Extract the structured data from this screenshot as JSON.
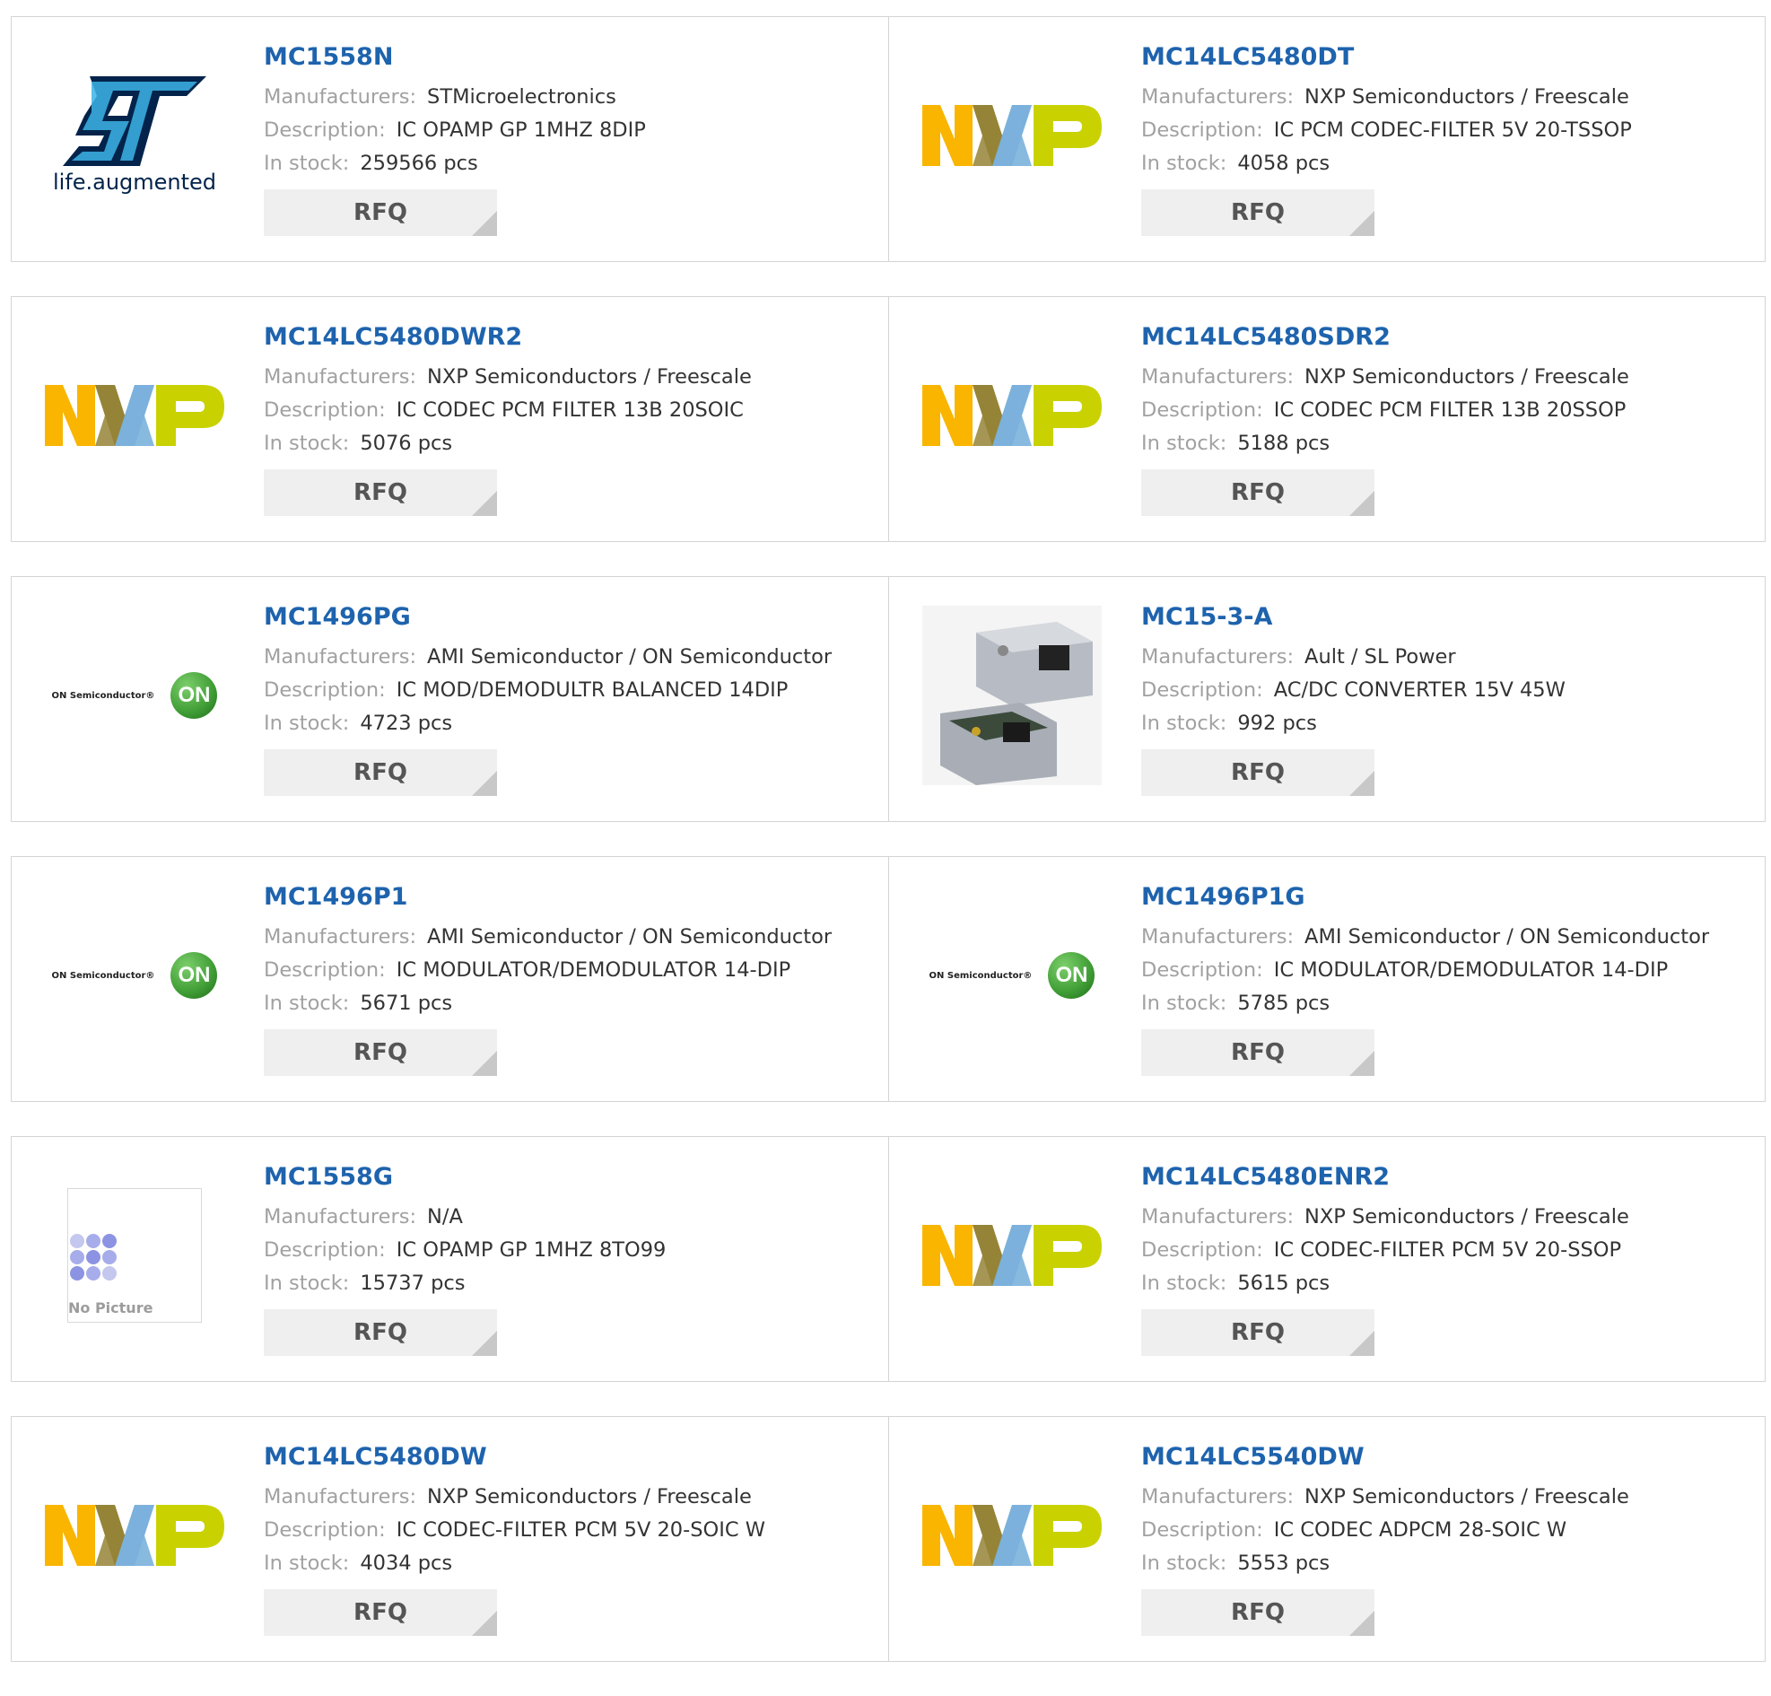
{
  "labels": {
    "manufacturers": "Manufacturers:",
    "description": "Description:",
    "in_stock": "In stock:",
    "rfq": "RFQ"
  },
  "products": [
    {
      "part": "MC1558N",
      "manufacturer": "STMicroelectronics",
      "description": "IC OPAMP GP 1MHZ 8DIP",
      "stock": "259566 pcs",
      "logo": "st-logo",
      "logo_text": "life.augmented"
    },
    {
      "part": "MC14LC5480DT",
      "manufacturer": "NXP Semiconductors / Freescale",
      "description": "IC PCM CODEC-FILTER 5V 20-TSSOP",
      "stock": "4058 pcs",
      "logo": "nxp-logo"
    },
    {
      "part": "MC14LC5480DWR2",
      "manufacturer": "NXP Semiconductors / Freescale",
      "description": "IC CODEC PCM FILTER 13B 20SOIC",
      "stock": "5076 pcs",
      "logo": "nxp-logo"
    },
    {
      "part": "MC14LC5480SDR2",
      "manufacturer": "NXP Semiconductors / Freescale",
      "description": "IC CODEC PCM FILTER 13B 20SSOP",
      "stock": "5188 pcs",
      "logo": "nxp-logo"
    },
    {
      "part": "MC1496PG",
      "manufacturer": "AMI Semiconductor / ON Semiconductor",
      "description": "IC MOD/DEMODULTR BALANCED 14DIP",
      "stock": "4723 pcs",
      "logo": "on-semiconductor-logo",
      "logo_text": "ON Semiconductor®",
      "logo_badge": "ON"
    },
    {
      "part": "MC15-3-A",
      "manufacturer": "Ault / SL Power",
      "description": "AC/DC CONVERTER 15V 45W",
      "stock": "992 pcs",
      "logo": "power-supply-photo"
    },
    {
      "part": "MC1496P1",
      "manufacturer": "AMI Semiconductor / ON Semiconductor",
      "description": "IC MODULATOR/DEMODULATOR 14-DIP",
      "stock": "5671 pcs",
      "logo": "on-semiconductor-logo",
      "logo_text": "ON Semiconductor®",
      "logo_badge": "ON"
    },
    {
      "part": "MC1496P1G",
      "manufacturer": "AMI Semiconductor / ON Semiconductor",
      "description": "IC MODULATOR/DEMODULATOR 14-DIP",
      "stock": "5785 pcs",
      "logo": "on-semiconductor-logo",
      "logo_text": "ON Semiconductor®",
      "logo_badge": "ON"
    },
    {
      "part": "MC1558G",
      "manufacturer": "N/A",
      "description": "IC OPAMP GP 1MHZ 8TO99",
      "stock": "15737 pcs",
      "logo": "no-picture-placeholder",
      "logo_text": "No Picture"
    },
    {
      "part": "MC14LC5480ENR2",
      "manufacturer": "NXP Semiconductors / Freescale",
      "description": "IC CODEC-FILTER PCM 5V 20-SSOP",
      "stock": "5615 pcs",
      "logo": "nxp-logo"
    },
    {
      "part": "MC14LC5480DW",
      "manufacturer": "NXP Semiconductors / Freescale",
      "description": "IC CODEC-FILTER PCM 5V 20-SOIC W",
      "stock": "4034 pcs",
      "logo": "nxp-logo"
    },
    {
      "part": "MC14LC5540DW",
      "manufacturer": "NXP Semiconductors / Freescale",
      "description": "IC CODEC ADPCM 28-SOIC W",
      "stock": "5553 pcs",
      "logo": "nxp-logo"
    }
  ],
  "colors": {
    "link": "#1e63ad",
    "label": "#a1a1a1",
    "value": "#333333",
    "border": "#d4d4d4",
    "button_bg": "#efefef",
    "button_text": "#555555",
    "nxp_orange": "#f9b500",
    "nxp_olive": "#958437",
    "nxp_blue": "#7bb1db",
    "nxp_green": "#c9d200",
    "st_blue": "#3cb4e6",
    "st_dark": "#03234b",
    "on_green": "#3f9c35"
  }
}
